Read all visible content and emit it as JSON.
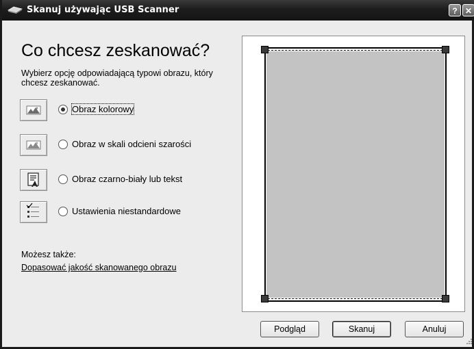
{
  "window": {
    "title": "Skanuj używając USB Scanner",
    "help_label": "?",
    "close_label": "✕"
  },
  "main": {
    "heading": "Co chcesz zeskanować?",
    "instruction": "Wybierz opcję odpowiadającą typowi obrazu, który chcesz zeskanować.",
    "options": [
      {
        "label": "Obraz kolorowy",
        "selected": true,
        "icon": "color-photo-icon"
      },
      {
        "label": "Obraz w skali odcieni szarości",
        "selected": false,
        "icon": "grayscale-photo-icon"
      },
      {
        "label": "Obraz czarno-biały lub tekst",
        "selected": false,
        "icon": "text-document-icon"
      },
      {
        "label": "Ustawienia niestandardowe",
        "selected": false,
        "icon": "custom-settings-icon"
      }
    ],
    "also_label": "Możesz także:",
    "adjust_link": "Dopasować jakość skanowanego obrazu"
  },
  "buttons": {
    "preview": "Podgląd",
    "scan": "Skanuj",
    "cancel": "Anuluj"
  }
}
